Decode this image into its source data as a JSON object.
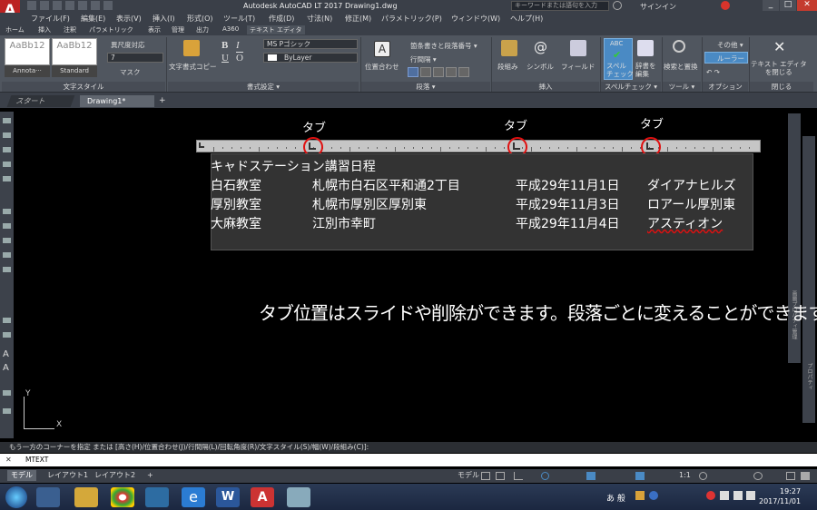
{
  "app": {
    "title": "Autodesk AutoCAD LT 2017    Drawing1.dwg",
    "search_placeholder": "キーワードまたは語句を入力",
    "signin": "サインイン",
    "app_button": "A"
  },
  "menubar": [
    "ファイル(F)",
    "編集(E)",
    "表示(V)",
    "挿入(I)",
    "形式(O)",
    "ツール(T)",
    "作成(D)",
    "寸法(N)",
    "修正(M)",
    "パラメトリック(P)",
    "ウィンドウ(W)",
    "ヘルプ(H)"
  ],
  "ribbon_tabs": [
    "ホーム",
    "挿入",
    "注釈",
    "パラメトリック",
    "表示",
    "管理",
    "出力",
    "A360",
    "テキスト エディタ"
  ],
  "ribbon": {
    "styles": [
      "AaBb12",
      "AaBb12"
    ],
    "style_names": [
      "Annota···",
      "Standard"
    ],
    "annotative": "異尺度対応",
    "text_height": "7",
    "mask": "マスク",
    "panel_text_style": "文字スタイル",
    "match": "文字書式コピー",
    "bold": "B",
    "italic": "I",
    "underline": "U",
    "overline": "O",
    "font": "MS Pゴシック",
    "color": "ByLayer",
    "panel_formatting": "書式設定 ▾",
    "justify": "位置合わせ",
    "bullets": "箇条書きと段落番号 ▾",
    "linespacing": "行間隔 ▾",
    "panel_paragraph": "段落 ▾",
    "columns": "段組み",
    "symbol": "シンボル",
    "field": "フィールド",
    "panel_insert": "挿入",
    "spell_abc": "ABC",
    "spell": "スペル\nチェック",
    "dict": "辞書を\n編集",
    "panel_spell": "スペルチェック ▾",
    "findreplace": "検索と置換",
    "panel_tools": "ツール ▾",
    "more": "その他 ▾",
    "ruler": "ルーラー",
    "panel_options": "オプション",
    "close_editor": "テキスト エディタ\nを閉じる",
    "panel_close": "閉じる"
  },
  "doc_tabs": [
    "スタート",
    "Drawing1*",
    "+"
  ],
  "canvas": {
    "tab_labels": [
      "タブ",
      "タブ",
      "タブ"
    ],
    "title_line": "キャドステーション講習日程",
    "rows": [
      [
        "白石教室",
        "札幌市白石区平和通2丁目",
        "平成29年11月1日",
        "ダイアナヒルズ"
      ],
      [
        "厚別教室",
        "札幌市厚別区厚別東",
        "平成29年11月3日",
        "ロアール厚別東"
      ],
      [
        "大麻教室",
        "江別市幸町",
        "平成29年11月4日",
        "アスティオン"
      ]
    ],
    "caption": "タブ位置はスライドや削除ができます。段落ごとに変えることができます。",
    "ucs_x": "X",
    "ucs_y": "Y",
    "right_panel_1": "画層プロパティ管理",
    "right_panel_2": "プロパティ"
  },
  "command_line": "もう一方のコーナーを指定 または [高さ(H)/位置合わせ(J)/行間隔(L)/回転角度(R)/文字スタイル(S)/幅(W)/段組み(C)]:",
  "command_input": "MTEXT",
  "layout_tabs": [
    "モデル",
    "レイアウト1",
    "レイアウト2",
    "+"
  ],
  "status": {
    "model": "モデル",
    "scale": "1:1"
  },
  "taskbar": {
    "ime": "あ 般",
    "time": "19:27",
    "date": "2017/11/01"
  },
  "colors": {
    "accent_red": "#e01010",
    "ribbon_bg": "#50565f",
    "canvas_bg": "#000000"
  }
}
